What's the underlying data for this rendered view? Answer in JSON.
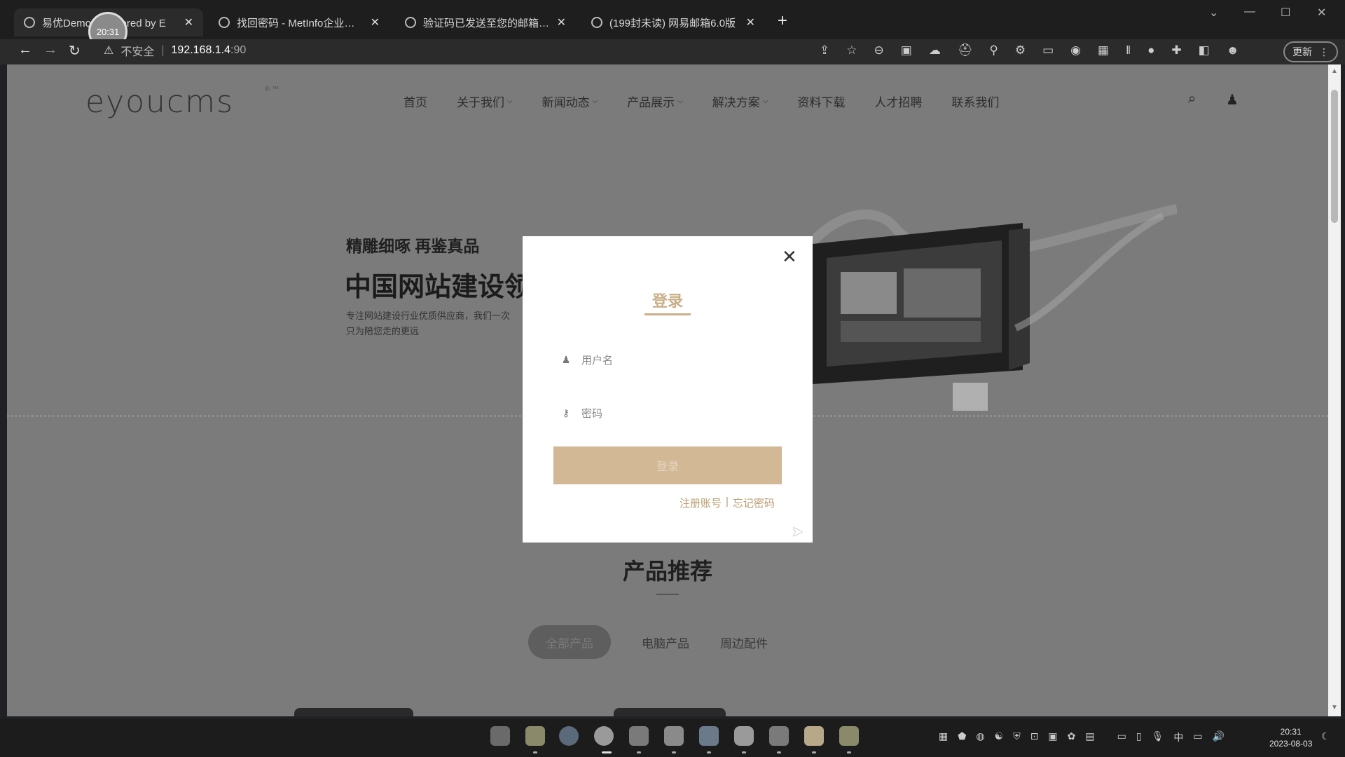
{
  "browser": {
    "clock_bubble": "20:31",
    "tabs": [
      {
        "title": "易优Demo - Powered by E",
        "active": true
      },
      {
        "title": "找回密码 - MetInfo企业网站管理",
        "active": false
      },
      {
        "title": "验证码已发送至您的邮箱，请登",
        "active": false
      },
      {
        "title": "(199封未读) 网易邮箱6.0版",
        "active": false
      }
    ],
    "new_tab": "+",
    "address": {
      "insecure": "不安全",
      "url": "192.168.1.4",
      "port": ":90"
    },
    "update_label": "更新"
  },
  "site": {
    "logo": "eyoucms",
    "menu": [
      {
        "label": "首页",
        "dropdown": false
      },
      {
        "label": "关于我们",
        "dropdown": true
      },
      {
        "label": "新闻动态",
        "dropdown": true
      },
      {
        "label": "产品展示",
        "dropdown": true
      },
      {
        "label": "解决方案",
        "dropdown": true
      },
      {
        "label": "资料下载",
        "dropdown": false
      },
      {
        "label": "人才招聘",
        "dropdown": false
      },
      {
        "label": "联系我们",
        "dropdown": false
      }
    ],
    "hero": {
      "tagline": "精雕细啄 再鉴真品",
      "title": "中国网站建设领",
      "desc_line1": "专注网站建设行业优质供应商，我们一次",
      "desc_line2": "只为陪您走的更远"
    },
    "section_title": "产品推荐",
    "categories": [
      "全部产品",
      "电脑产品",
      "周边配件"
    ]
  },
  "modal": {
    "title": "登录",
    "username_placeholder": "用户名",
    "password_placeholder": "密码",
    "submit_label": "登录",
    "register_link": "注册账号",
    "separator": "|",
    "forgot_link": "忘记密码"
  },
  "taskbar": {
    "time": "20:31",
    "date": "2023-08-03",
    "ime": "中"
  }
}
